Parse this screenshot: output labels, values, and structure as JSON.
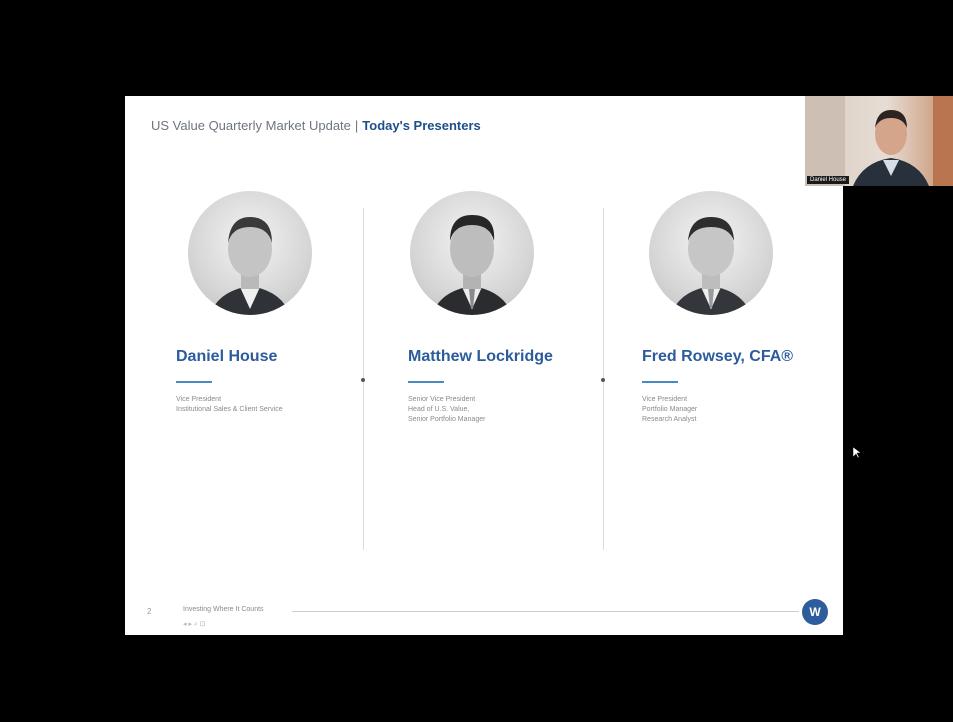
{
  "slide": {
    "title_plain": "US Value Quarterly Market Update",
    "title_sep": "|",
    "title_bold": "Today's Presenters",
    "page_number": "2",
    "footer_text": "Investing Where It Counts",
    "logo_text": "W"
  },
  "presenters": [
    {
      "name": "Daniel House",
      "roles": [
        "Vice President",
        "Institutional Sales & Client Service"
      ]
    },
    {
      "name": "Matthew Lockridge",
      "roles": [
        "Senior Vice President",
        "Head of U.S. Value,",
        "Senior Portfolio Manager"
      ]
    },
    {
      "name": "Fred Rowsey, CFA®",
      "roles": [
        "Vice President",
        "Portfolio Manager",
        "Research Analyst"
      ]
    }
  ],
  "webcam": {
    "label": "Daniel House"
  },
  "colors": {
    "accent": "#2c5c9c",
    "underline": "#4a8ac4",
    "logo": "#2d5d9c"
  }
}
